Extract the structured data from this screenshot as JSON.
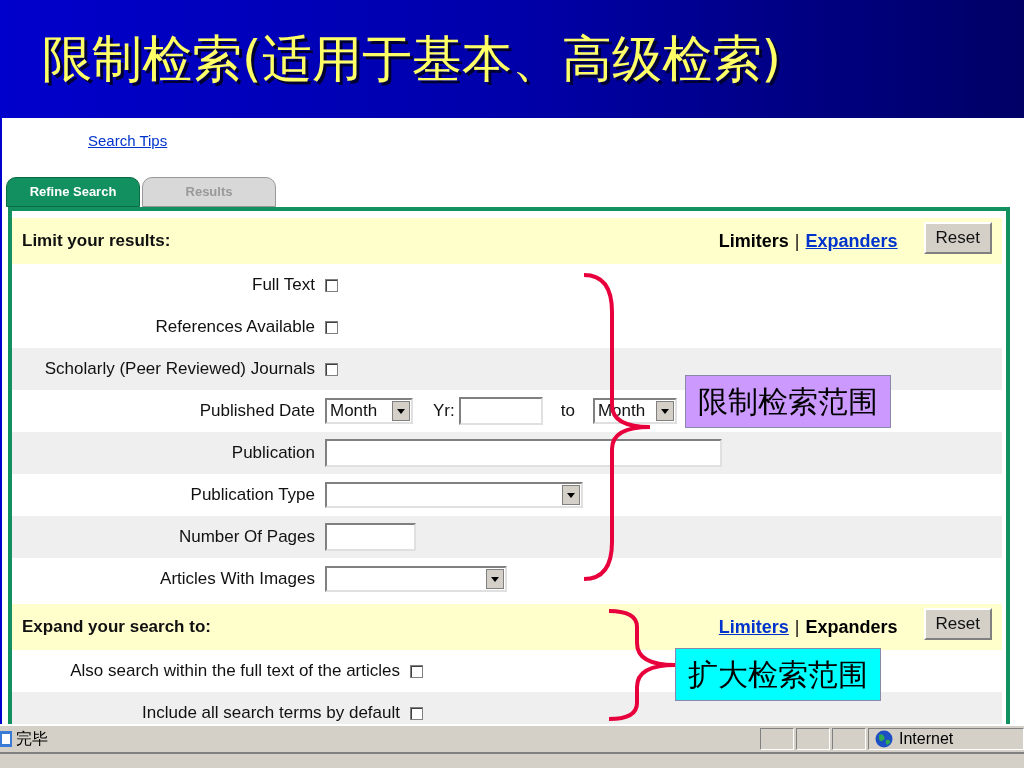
{
  "slide_title": "限制检索(适用于基本、高级检索)",
  "search_tips": "Search Tips",
  "tabs": [
    {
      "label": "Refine Search",
      "selected": true
    },
    {
      "label": "Results",
      "selected": false
    }
  ],
  "limit_section": {
    "title": "Limit your results:",
    "links": [
      {
        "label": "Limiters",
        "selected": true
      },
      {
        "label": "Expanders",
        "selected": false
      }
    ],
    "separator": "|",
    "reset": "Reset"
  },
  "limiters": [
    {
      "kind": "checkbox",
      "label": "Full Text",
      "checked": false
    },
    {
      "kind": "checkbox",
      "label": "References Available",
      "checked": false
    },
    {
      "kind": "checkbox",
      "label": "Scholarly (Peer Reviewed) Journals",
      "checked": false
    },
    {
      "kind": "date",
      "label": "Published Date",
      "month": "Month",
      "yr_label": "Yr:",
      "to": "to",
      "month_to": "Month"
    },
    {
      "kind": "text",
      "label": "Publication"
    },
    {
      "kind": "select",
      "label": "Publication Type"
    },
    {
      "kind": "text",
      "label": "Number Of Pages"
    },
    {
      "kind": "select",
      "label": "Articles With Images"
    }
  ],
  "expand_section": {
    "title": "Expand your search to:",
    "links": [
      {
        "label": "Limiters",
        "selected": false
      },
      {
        "label": "Expanders",
        "selected": true
      }
    ],
    "separator": "|",
    "reset": "Reset"
  },
  "expanders": [
    {
      "kind": "checkbox",
      "label": "Also search within the full text of the articles",
      "checked": false
    },
    {
      "kind": "checkbox",
      "label": "Include all search terms by default",
      "checked": false
    }
  ],
  "annotations": [
    {
      "text": "限制检索范围",
      "color": "#cc99ff"
    },
    {
      "text": "扩大检索范围",
      "color": "#00ffff"
    }
  ],
  "status_bar": {
    "text": "完毕",
    "zone": "Internet"
  }
}
